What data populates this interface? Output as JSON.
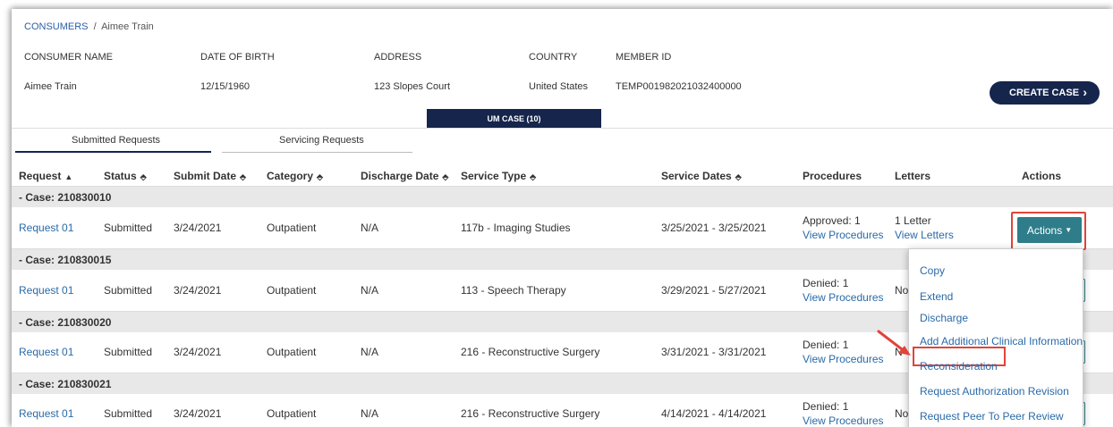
{
  "breadcrumb": {
    "root": "CONSUMERS",
    "separator": "/",
    "current": "Aimee Train"
  },
  "consumer": {
    "labels": {
      "name": "CONSUMER NAME",
      "dob": "DATE OF BIRTH",
      "address": "ADDRESS",
      "country": "COUNTRY",
      "member_id": "MEMBER ID"
    },
    "values": {
      "name": "Aimee Train",
      "dob": "12/15/1960",
      "address": "123 Slopes Court",
      "country": "United States",
      "member_id": "TEMP001982021032400000"
    }
  },
  "create_case_label": "CREATE CASE",
  "create_case_chevron": "›",
  "um_case_label": "UM CASE (10)",
  "tabs": [
    {
      "label": "Submitted Requests"
    },
    {
      "label": "Servicing Requests"
    }
  ],
  "table": {
    "headers": [
      "Request",
      "Status",
      "Submit Date",
      "Category",
      "Discharge Date",
      "Service Type",
      "Service Dates",
      "Procedures",
      "Letters",
      "Actions"
    ],
    "sort_up": "▲",
    "sort_both": "⬘",
    "cases": [
      {
        "label": "- Case: 210830010",
        "row": {
          "request": "Request 01",
          "status": "Submitted",
          "submit_date": "3/24/2021",
          "category": "Outpatient",
          "discharge": "N/A",
          "service_type": "117b - Imaging Studies",
          "service_dates": "3/25/2021 - 3/25/2021",
          "proc_status": "Approved: 1",
          "proc_link": "View Procedures",
          "letters": "1 Letter",
          "letters_link": "View Letters"
        }
      },
      {
        "label": "- Case: 210830015",
        "row": {
          "request": "Request 01",
          "status": "Submitted",
          "submit_date": "3/24/2021",
          "category": "Outpatient",
          "discharge": "N/A",
          "service_type": "113 - Speech Therapy",
          "service_dates": "3/29/2021 - 5/27/2021",
          "proc_status": "Denied: 1",
          "proc_link": "View Procedures",
          "letters": "No"
        }
      },
      {
        "label": "- Case: 210830020",
        "row": {
          "request": "Request 01",
          "status": "Submitted",
          "submit_date": "3/24/2021",
          "category": "Outpatient",
          "discharge": "N/A",
          "service_type": "216 - Reconstructive Surgery",
          "service_dates": "3/31/2021 - 3/31/2021",
          "proc_status": "Denied: 1",
          "proc_link": "View Procedures",
          "letters": "N"
        }
      },
      {
        "label": "- Case: 210830021",
        "row": {
          "request": "Request 01",
          "status": "Submitted",
          "submit_date": "3/24/2021",
          "category": "Outpatient",
          "discharge": "N/A",
          "service_type": "216 - Reconstructive Surgery",
          "service_dates": "4/14/2021 - 4/14/2021",
          "proc_status": "Denied: 1",
          "proc_link": "View Procedures",
          "letters": "No"
        }
      }
    ]
  },
  "actions_button": {
    "label": "Actions",
    "caret": "▼"
  },
  "actions_menu": {
    "items": [
      "Copy",
      "Extend",
      "Discharge",
      "Add Additional Clinical Information",
      "Reconsideration",
      "Request Authorization Revision",
      "Request Peer To Peer Review"
    ],
    "highlighted": "Reconsideration"
  },
  "colors": {
    "navy": "#15254c",
    "teal": "#2f7d8a",
    "link": "#2a6aa8",
    "highlight": "#e0443a"
  }
}
